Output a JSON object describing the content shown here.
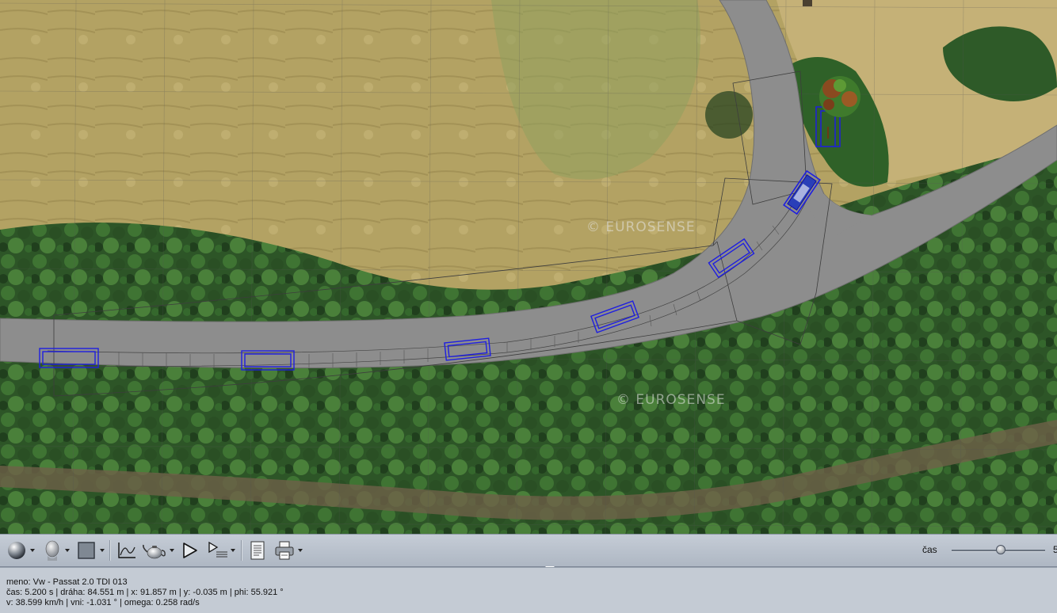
{
  "viewport": {
    "watermarks": [
      "© EUROSENSE",
      "© EUROSENSE"
    ]
  },
  "toolbar": {
    "icons": [
      "view-sphere-icon",
      "driver-head-icon",
      "square-frame-icon",
      "graph-icon",
      "teapot-icon",
      "play-icon",
      "play-steps-icon",
      "document-icon",
      "printer-icon"
    ],
    "time_label": "čas",
    "time_value": "5"
  },
  "status": {
    "line1": "meno: Vw - Passat 2.0 TDI 013",
    "line2": "čas: 5.200 s | dráha: 84.551 m | x: 91.857 m | y: -0.035 m | phi: 55.921 °",
    "line3": "v: 38.599 km/h | vni: -1.031 ° | omega: 0.258 rad/s"
  },
  "colors": {
    "toolbar_bg": "#b8c0cb",
    "status_bg": "#c4cbd4",
    "vehicle_outline": "#1e1ee0",
    "road": "#8f8f8f",
    "field": "#b6a566",
    "forest": "#2f5a2a"
  }
}
